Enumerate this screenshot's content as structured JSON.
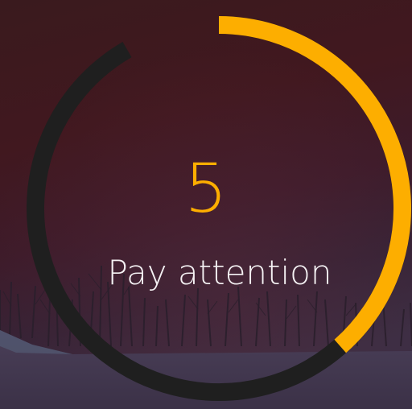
{
  "countdown": {
    "value": "5",
    "label": "Pay attention"
  },
  "progress": {
    "fraction": 0.42
  },
  "colors": {
    "progress": "#FDAE00",
    "track": "#1f1f1f",
    "label": "#f4f1f3"
  },
  "background": {
    "scene": "winter-trees-at-dusk"
  }
}
